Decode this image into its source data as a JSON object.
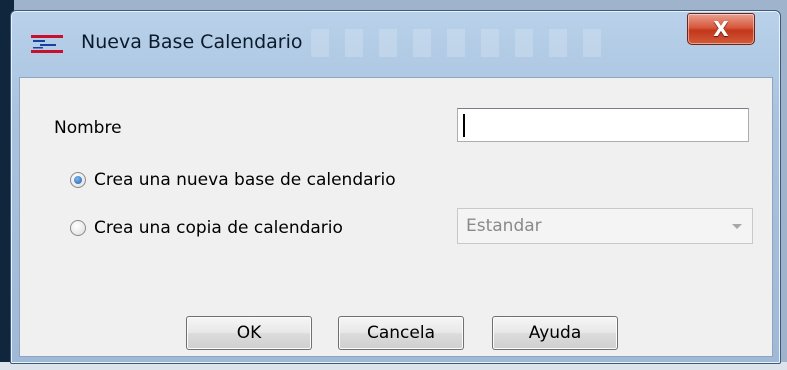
{
  "window": {
    "title": "Nueva Base Calendario",
    "close_label": "X"
  },
  "form": {
    "name_label": "Nombre",
    "name_value": "",
    "options": [
      {
        "label": "Crea una nueva base de calendario",
        "checked": true
      },
      {
        "label": "Crea una copia de calendario",
        "checked": false
      }
    ],
    "copy_combo_value": "Estandar"
  },
  "buttons": {
    "ok": "OK",
    "cancel": "Cancela",
    "help": "Ayuda"
  }
}
